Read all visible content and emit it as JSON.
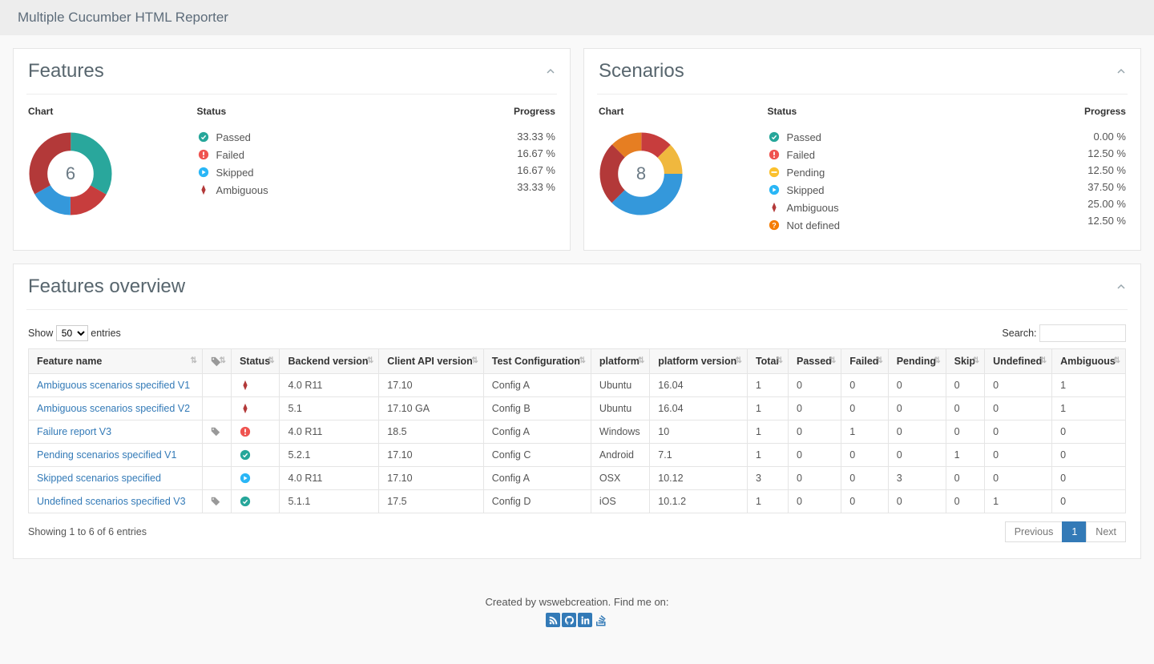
{
  "app_title": "Multiple Cucumber HTML Reporter",
  "colors": {
    "passed": "#29a79c",
    "failed": "#c73d3d",
    "pending": "#f0b83e",
    "skipped": "#3498db",
    "ambiguous": "#b33939",
    "notdefined": "#e67e22"
  },
  "features_panel": {
    "title": "Features",
    "headers": {
      "chart": "Chart",
      "status": "Status",
      "progress": "Progress"
    },
    "total": "6",
    "items": [
      {
        "kind": "passed",
        "label": "Passed",
        "pct": "33.33 %"
      },
      {
        "kind": "failed",
        "label": "Failed",
        "pct": "16.67 %"
      },
      {
        "kind": "skipped",
        "label": "Skipped",
        "pct": "16.67 %"
      },
      {
        "kind": "ambiguous",
        "label": "Ambiguous",
        "pct": "33.33 %"
      }
    ]
  },
  "scenarios_panel": {
    "title": "Scenarios",
    "headers": {
      "chart": "Chart",
      "status": "Status",
      "progress": "Progress"
    },
    "total": "8",
    "items": [
      {
        "kind": "passed",
        "label": "Passed",
        "pct": "0.00 %"
      },
      {
        "kind": "failed",
        "label": "Failed",
        "pct": "12.50 %"
      },
      {
        "kind": "pending",
        "label": "Pending",
        "pct": "12.50 %"
      },
      {
        "kind": "skipped",
        "label": "Skipped",
        "pct": "37.50 %"
      },
      {
        "kind": "ambiguous",
        "label": "Ambiguous",
        "pct": "25.00 %"
      },
      {
        "kind": "notdefined",
        "label": "Not defined",
        "pct": "12.50 %"
      }
    ]
  },
  "overview": {
    "title": "Features overview",
    "show_label": "Show",
    "length_value": "50",
    "entries_label": "entries",
    "search_label": "Search:",
    "columns": [
      "Feature name",
      "",
      "Status",
      "Backend version",
      "Client API version",
      "Test Configuration",
      "platform",
      "platform version",
      "Total",
      "Passed",
      "Failed",
      "Pending",
      "Skip",
      "Undefined",
      "Ambiguous"
    ],
    "rows": [
      {
        "name": "Ambiguous scenarios specified V1",
        "tagged": false,
        "status": "ambiguous",
        "backend": "4.0 R11",
        "client": "17.10",
        "config": "Config A",
        "platform": "Ubuntu",
        "pver": "16.04",
        "total": "1",
        "passed": "0",
        "failed": "0",
        "pending": "0",
        "skip": "0",
        "undef": "0",
        "amb": "1"
      },
      {
        "name": "Ambiguous scenarios specified V2",
        "tagged": false,
        "status": "ambiguous",
        "backend": "5.1",
        "client": "17.10 GA",
        "config": "Config B",
        "platform": "Ubuntu",
        "pver": "16.04",
        "total": "1",
        "passed": "0",
        "failed": "0",
        "pending": "0",
        "skip": "0",
        "undef": "0",
        "amb": "1"
      },
      {
        "name": "Failure report V3",
        "tagged": true,
        "status": "failed",
        "backend": "4.0 R11",
        "client": "18.5",
        "config": "Config A",
        "platform": "Windows",
        "pver": "10",
        "total": "1",
        "passed": "0",
        "failed": "1",
        "pending": "0",
        "skip": "0",
        "undef": "0",
        "amb": "0"
      },
      {
        "name": "Pending scenarios specified V1",
        "tagged": false,
        "status": "passed",
        "backend": "5.2.1",
        "client": "17.10",
        "config": "Config C",
        "platform": "Android",
        "pver": "7.1",
        "total": "1",
        "passed": "0",
        "failed": "0",
        "pending": "0",
        "skip": "1",
        "undef": "0",
        "amb": "0"
      },
      {
        "name": "Skipped scenarios specified",
        "tagged": false,
        "status": "skipped",
        "backend": "4.0 R11",
        "client": "17.10",
        "config": "Config A",
        "platform": "OSX",
        "pver": "10.12",
        "total": "3",
        "passed": "0",
        "failed": "0",
        "pending": "3",
        "skip": "0",
        "undef": "0",
        "amb": "0"
      },
      {
        "name": "Undefined scenarios specified V3",
        "tagged": true,
        "status": "passed",
        "backend": "5.1.1",
        "client": "17.5",
        "config": "Config D",
        "platform": "iOS",
        "pver": "10.1.2",
        "total": "1",
        "passed": "0",
        "failed": "0",
        "pending": "0",
        "skip": "0",
        "undef": "1",
        "amb": "0"
      }
    ],
    "info": "Showing 1 to 6 of 6 entries",
    "pagination": {
      "previous": "Previous",
      "pages": [
        "1"
      ],
      "next": "Next",
      "active": "1"
    }
  },
  "footer": {
    "text": "Created by wswebcreation. Find me on:"
  },
  "chart_data": [
    {
      "type": "pie",
      "title": "Features",
      "categories": [
        "Passed",
        "Failed",
        "Skipped",
        "Ambiguous"
      ],
      "values": [
        33.33,
        16.67,
        16.67,
        33.33
      ],
      "total": 6
    },
    {
      "type": "pie",
      "title": "Scenarios",
      "categories": [
        "Passed",
        "Failed",
        "Pending",
        "Skipped",
        "Ambiguous",
        "Not defined"
      ],
      "values": [
        0.0,
        12.5,
        12.5,
        37.5,
        25.0,
        12.5
      ],
      "total": 8
    }
  ]
}
